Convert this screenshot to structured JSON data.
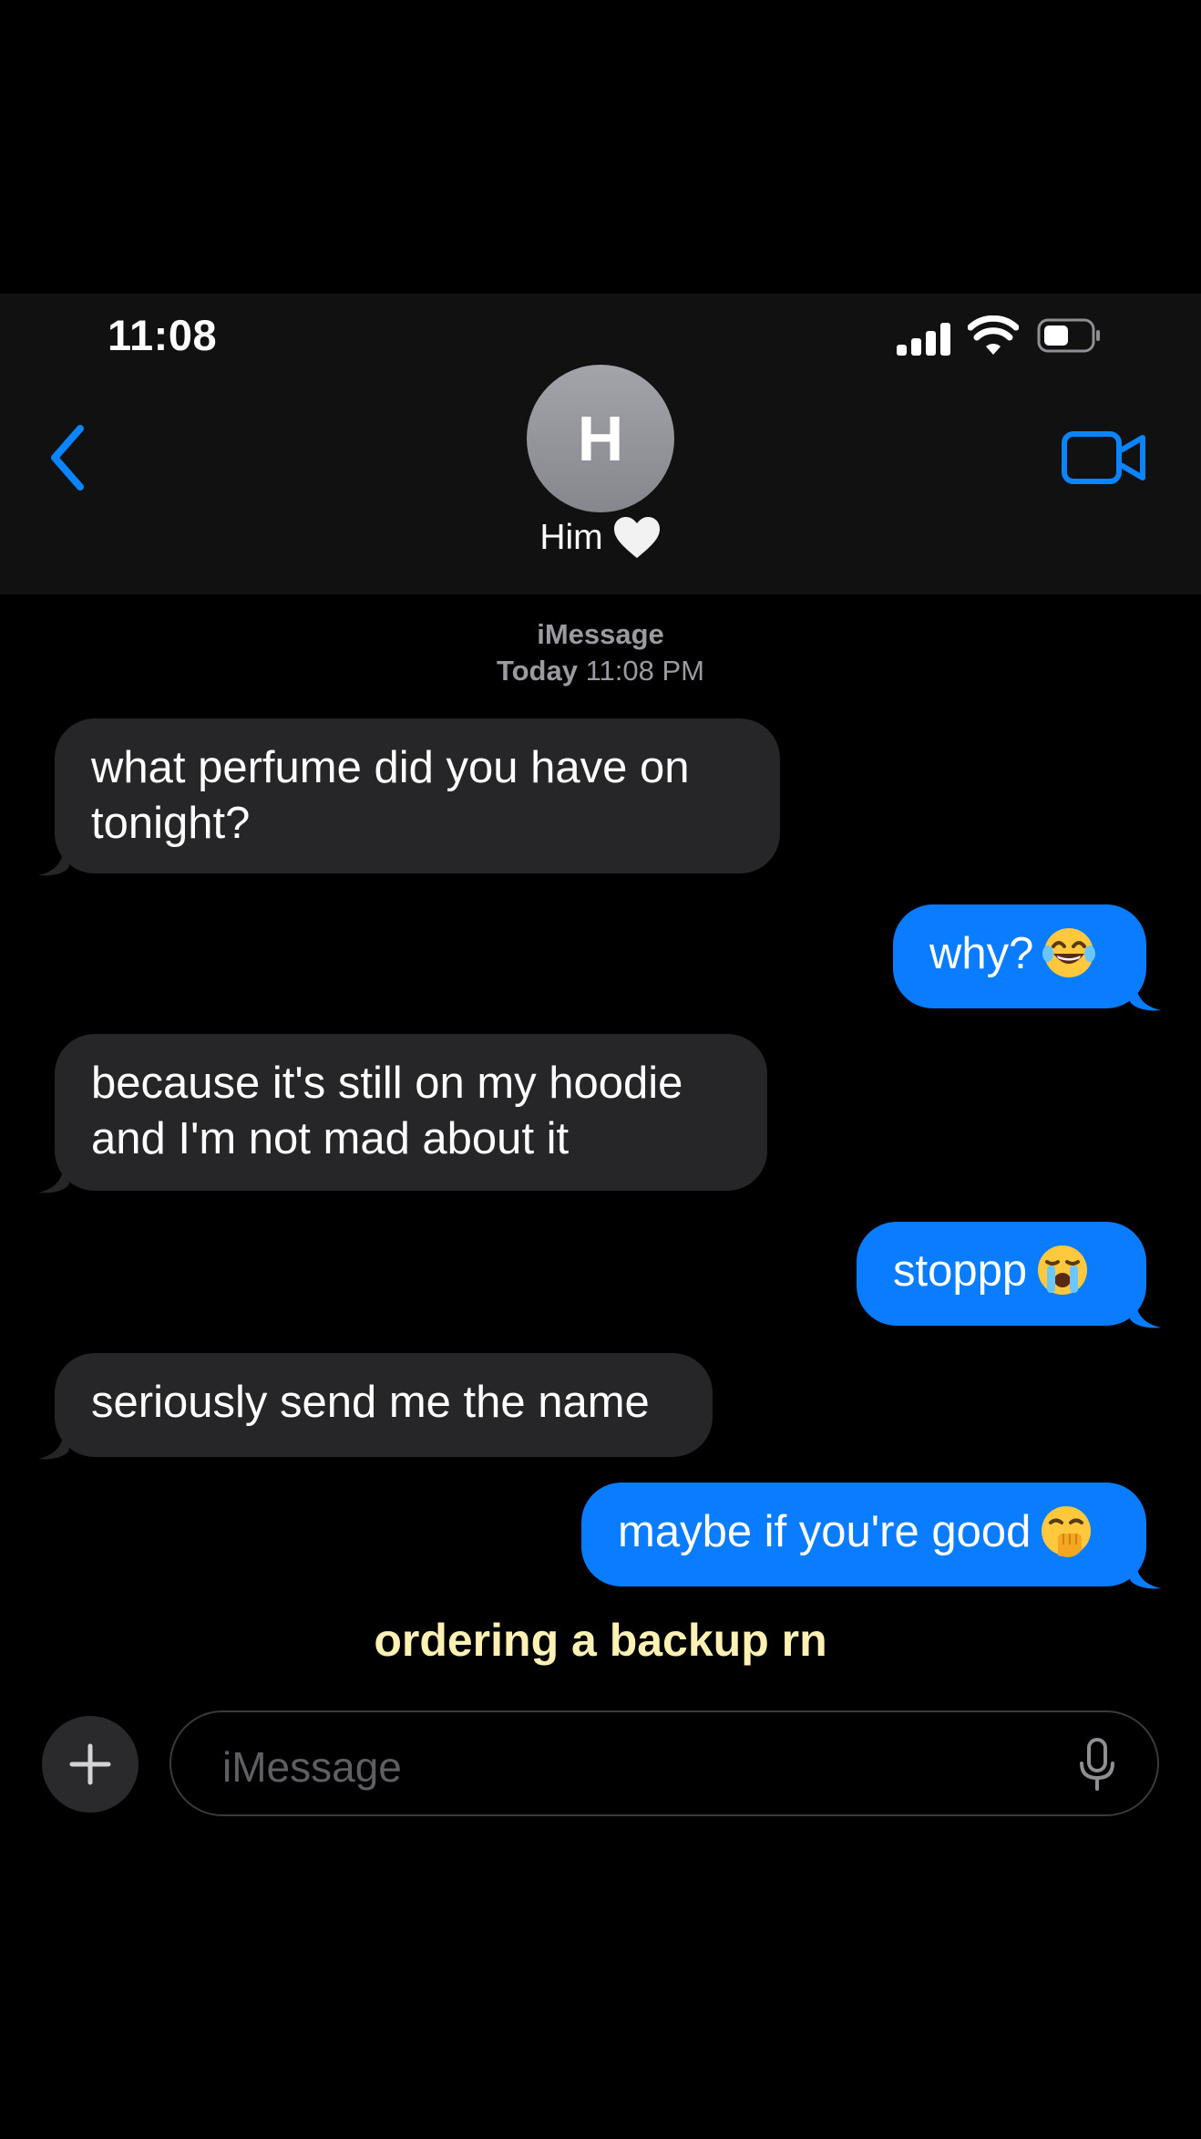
{
  "status_bar": {
    "time": "11:08"
  },
  "header": {
    "avatar_initial": "H",
    "contact_name": "Him"
  },
  "thread": {
    "service": "iMessage",
    "day": "Today",
    "time": "11:08 PM"
  },
  "messages": [
    {
      "side": "in",
      "text": "what perfume did you have on\ntonight?"
    },
    {
      "side": "out",
      "text": "why?",
      "emoji": "laughing-tears-emoji"
    },
    {
      "side": "in",
      "text": "because it's still on my hoodie\nand I'm not mad about it"
    },
    {
      "side": "out",
      "text": "stoppp",
      "emoji": "crying-emoji"
    },
    {
      "side": "in",
      "text": "seriously send me the name"
    },
    {
      "side": "out",
      "text": "maybe if you're good",
      "emoji": "hand-over-mouth-emoji"
    }
  ],
  "caption": "ordering a backup rn",
  "composer": {
    "placeholder": "iMessage"
  },
  "colors": {
    "outgoing": "#0a7cff",
    "incoming": "#262628",
    "accent": "#0a84ff",
    "caption": "#fff1b4"
  }
}
